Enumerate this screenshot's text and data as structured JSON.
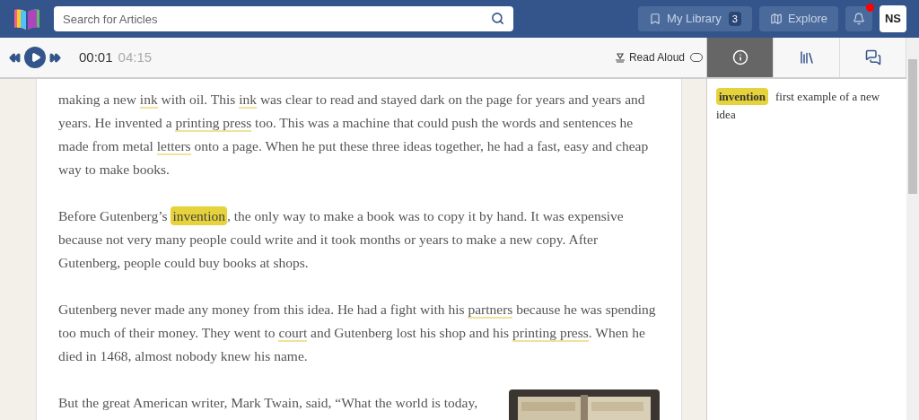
{
  "header": {
    "search": {
      "placeholder": "Search for Articles"
    },
    "library": {
      "label": "My Library",
      "count": "3"
    },
    "explore": {
      "label": "Explore"
    },
    "notifications": {
      "unread": true
    },
    "avatar": "NS"
  },
  "player": {
    "playing": false,
    "current": "00:01",
    "duration": "04:15",
    "read_aloud": {
      "label": "Read Aloud",
      "on": false
    }
  },
  "tabs": [
    {
      "kind": "info",
      "selected": true
    },
    {
      "kind": "library",
      "selected": false
    },
    {
      "kind": "comments",
      "selected": false
    }
  ],
  "article": {
    "paragraphs": [
      [
        {
          "kind": "text",
          "text": "making a new "
        },
        {
          "kind": "term",
          "text": "ink"
        },
        {
          "kind": "text",
          "text": " with oil. This "
        },
        {
          "kind": "term",
          "text": "ink"
        },
        {
          "kind": "text",
          "text": " was clear to read and stayed dark on the page for years and years and years. He invented a "
        },
        {
          "kind": "term",
          "text": "printing press"
        },
        {
          "kind": "text",
          "text": " too. This was a machine that could push the words and sentences he made from metal "
        },
        {
          "kind": "term",
          "text": "letters"
        },
        {
          "kind": "text",
          "text": " onto a page. When he put these three ideas together, he had a fast, easy and cheap way to make books."
        }
      ],
      [
        {
          "kind": "text",
          "text": "Before Gutenberg’s "
        },
        {
          "kind": "highlight",
          "text": "invention"
        },
        {
          "kind": "text",
          "text": ", the only way to make a book was to copy it by hand. It was expensive because not very many people could write and it took months or years to make a new copy. After Gutenberg, people could buy books at shops."
        }
      ],
      [
        {
          "kind": "text",
          "text": "Gutenberg never made any money from this idea. He had a fight with his "
        },
        {
          "kind": "term",
          "text": "partners"
        },
        {
          "kind": "text",
          "text": " because he was spending too much of their money. They went to "
        },
        {
          "kind": "term",
          "text": "court"
        },
        {
          "kind": "text",
          "text": " and Gutenberg lost his shop and his "
        },
        {
          "kind": "term",
          "text": "printing press"
        },
        {
          "kind": "text",
          "text": ". When he died in 1468, almost nobody knew his name."
        }
      ],
      [
        {
          "kind": "picture"
        },
        {
          "kind": "text",
          "text": "But the great American writer, Mark Twain, said, “What the world is today,"
        }
      ]
    ]
  },
  "glossary": [
    {
      "term": "invention",
      "definition": "first example of a new idea"
    }
  ]
}
